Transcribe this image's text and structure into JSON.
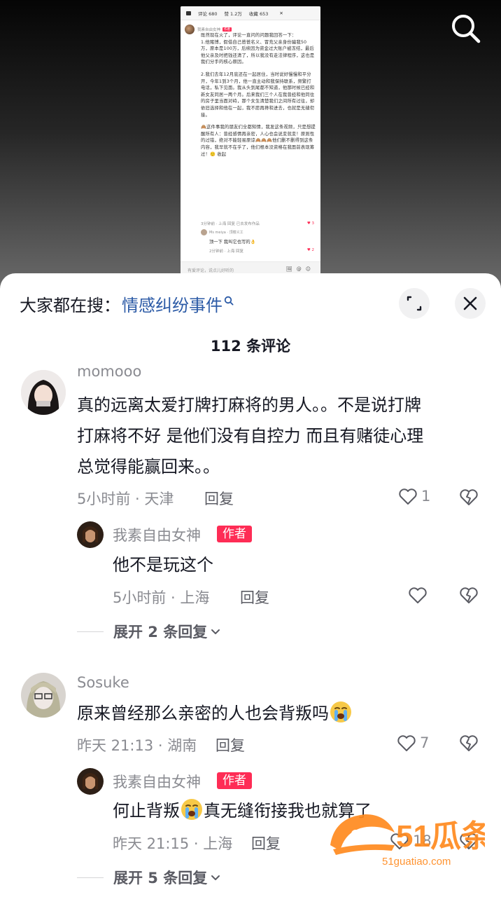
{
  "embed": {
    "tabs": [
      "评论 680",
      "赞 1.2万",
      "收藏 653"
    ],
    "author_name": "我素自由女神",
    "author_tag": "作者",
    "paragraphs": [
      "既然现在火了，评论一直问的问题我回答一下：",
      "1.他赌博，假借自己爸爸名义、冒充父亲身份骗我50万，原本是100万，后续因为资金过大账户被冻结，最后他父亲及时把钱还清了，所以我没有走法律程序，这也是我们分手的核心原因。",
      "2.我们去年12月底还在一起居住，当时说好慢慢和平分开，今年1到3个月，他一直主动和我保持联系，频繁打电话，私下见面。我从头到尾都不知道，他那时候已经和新女友同居一两个月。后来我们三个人在我曾经和他同住的房子里当面对峙，那个女生清楚我们之间所有过往，却依旧选择和他在一起，我不愿再搀和进去，也就是无缝衔接。",
      "🙈这件事我的朋友们全都知情，我发这条视频，只是想提醒所有人：曾经感情再亲密，人心也会说变就变！原则性的过错，绝对不能轻易原谅🙈🙈🙈他们删不删得到这条内容，我早就不在乎了，他们根本没资格在我面前表现筹过！🙂 收起"
    ],
    "meta": "3分钟前 · 上海   回复   已去发布作品",
    "like_count": "3",
    "sub_name": "Ms meiya · 顶楼义工",
    "sub_text": "顶一下 我叫它也写的👌",
    "sub_meta": "2分钟前 · 上海   回复",
    "sub_like": "2",
    "input_placeholder": "有爱评论，说点儿好听的",
    "input_icons": "🖼@☺"
  },
  "sheet": {
    "search_prefix": "大家都在搜：",
    "search_link": "情感纠纷事件",
    "comment_count": "112 条评论"
  },
  "comments": [
    {
      "username": "momooo",
      "lines": [
        "真的远离太爱打牌打麻将的男人。。不是说打牌",
        "打麻将不好 是他们没有自控力 而且有赌徒心理",
        "总觉得能赢回来。。"
      ],
      "time_loc": "5小时前 · 天津",
      "reply": "回复",
      "likes": "1",
      "author_reply": {
        "username": "我素自由女神",
        "tag": "作者",
        "text": "他不是玩这个",
        "time_loc": "5小时前 · 上海",
        "reply": "回复"
      },
      "expand": "展开 2 条回复"
    },
    {
      "username": "Sosuke",
      "text": "原来曾经那么亲密的人也会背叛吗",
      "time_loc": "昨天 21:13 · 湖南",
      "reply": "回复",
      "likes": "7",
      "author_reply": {
        "username": "我素自由女神",
        "tag": "作者",
        "text_before": "何止背叛",
        "text_after": "真无缝衔接我也就算了",
        "time_loc": "昨天 21:15 · 上海",
        "reply": "回复",
        "likes": "18"
      },
      "expand": "展开 5 条回复"
    }
  ],
  "watermark": {
    "brand": "51瓜条",
    "url": "51guatiao.com"
  }
}
